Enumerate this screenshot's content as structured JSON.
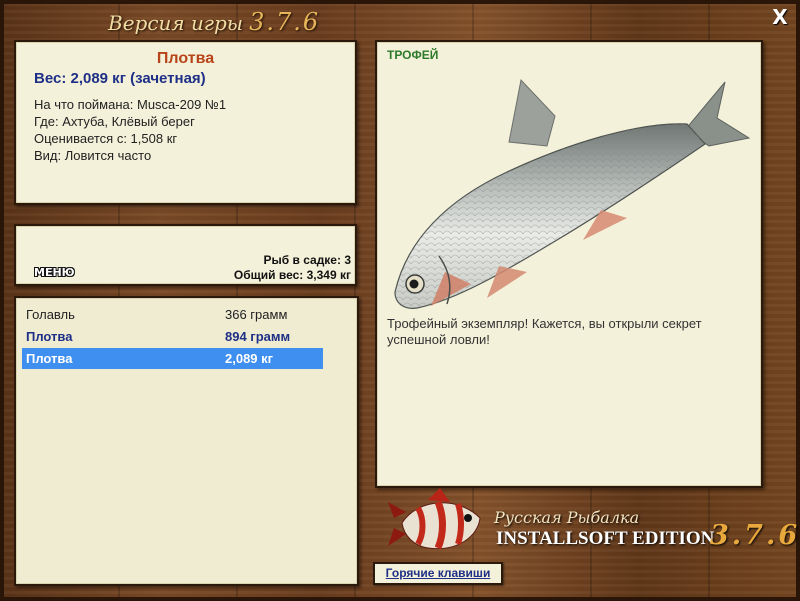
{
  "window": {
    "title_prefix": "Версия игры",
    "title_version": "3.7.6",
    "close_label": "X"
  },
  "fish_info": {
    "name": "Плотва",
    "weight": "Вес: 2,089 кг (зачетная)",
    "caught_with": "На что поймана: Musca-209 №1",
    "location": "Где: Ахтуба, Клёвый берег",
    "value_from": "Оценивается с: 1,508 кг",
    "frequency": "Вид: Ловится часто"
  },
  "cage": {
    "menu_label": "МЕНЮ",
    "count_text": "Рыб в садке: 3",
    "total_weight_text": "Общий вес: 3,349 кг"
  },
  "catch_list": [
    {
      "name": "Голавль",
      "weight": "366 грамм"
    },
    {
      "name": "Плотва",
      "weight": "894 грамм"
    },
    {
      "name": "Плотва",
      "weight": "2,089 кг"
    }
  ],
  "trophy": {
    "label": "ТРОФЕЙ",
    "description": "Трофейный экземпляр! Кажется, вы открыли секрет успешной ловли!"
  },
  "brand": {
    "name": "Русская Рыбалка",
    "edition": "INSTALLSOFT EDITION",
    "version": "3.7.6"
  },
  "hotkeys": {
    "label": "Горячие клавиши"
  },
  "colors": {
    "accent_blue": "#1e2f87",
    "fish_name": "#b8441a",
    "trophy_green": "#2c7a2a",
    "selection": "#3f8ff0"
  },
  "icons": {
    "trophy_fish": "roach-fish-image",
    "brand_fish": "red-striped-fish-logo"
  }
}
